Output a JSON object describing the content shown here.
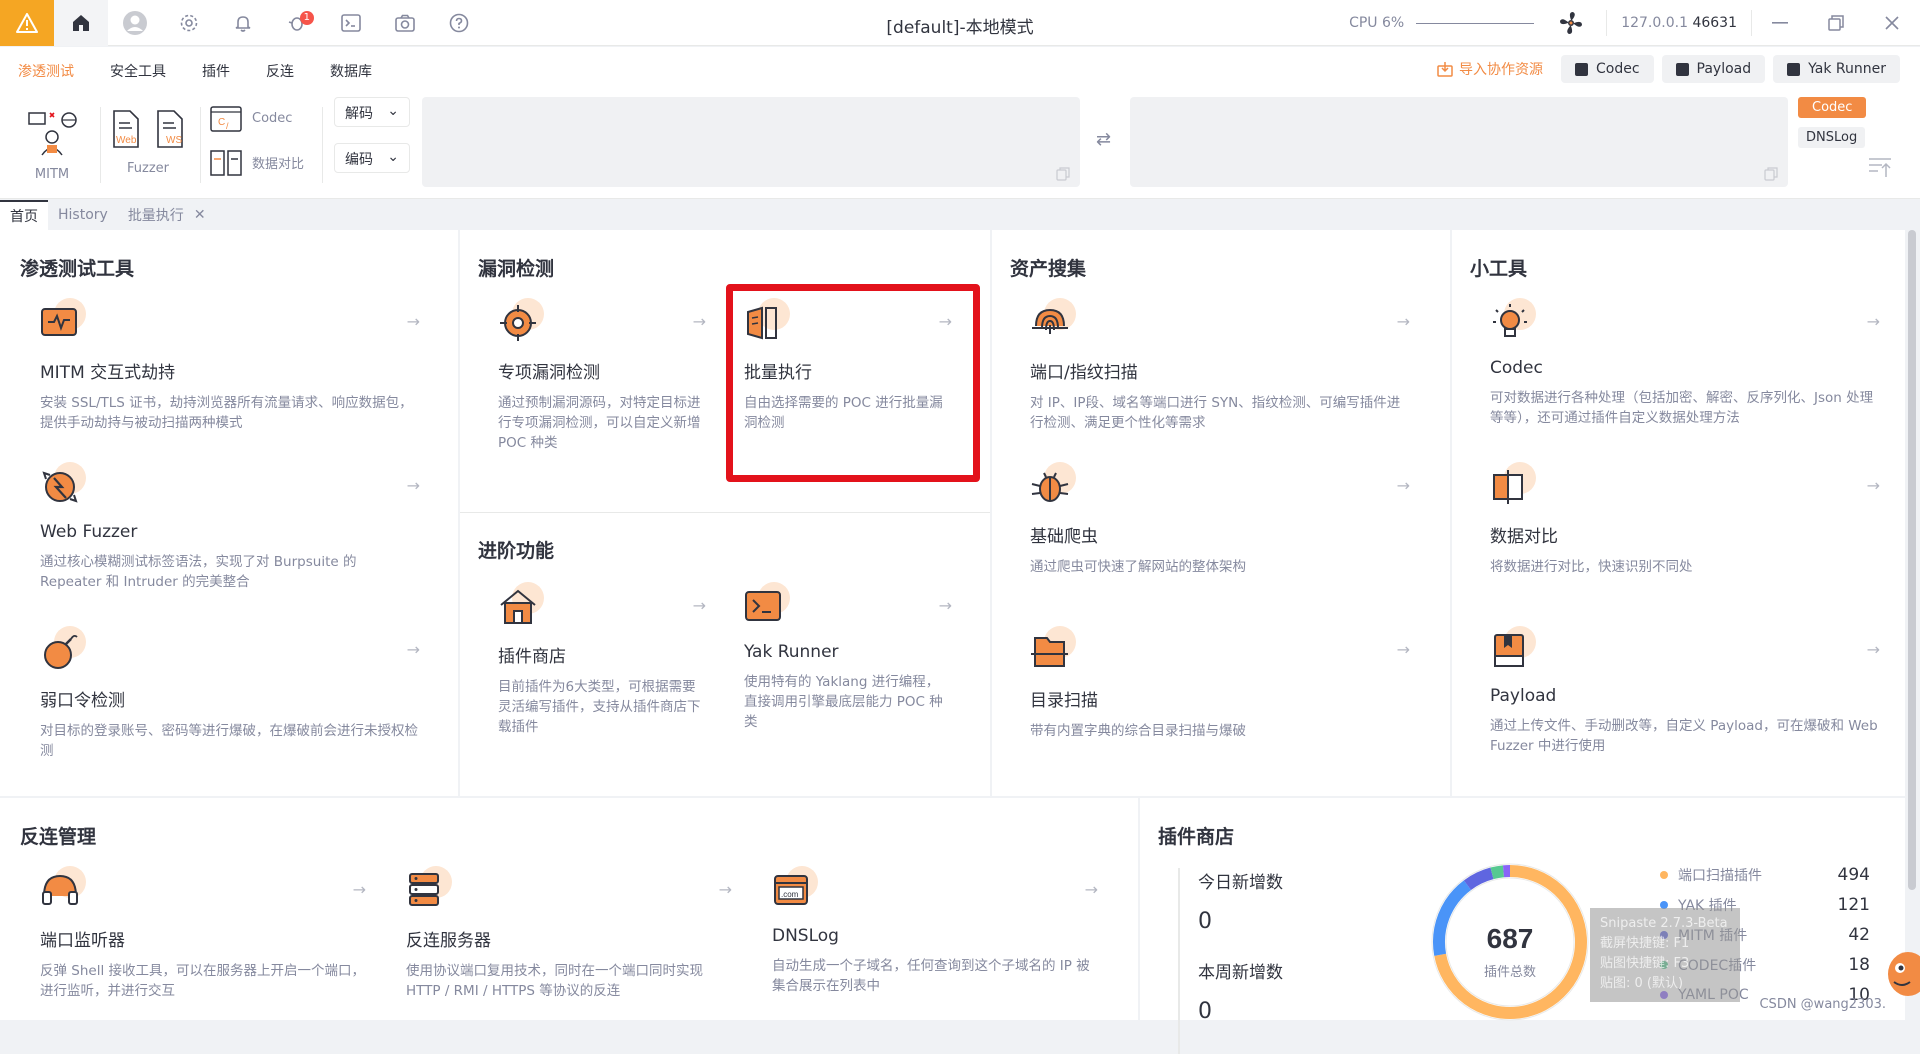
{
  "titlebar": {
    "title": "[default]-本地模式",
    "cpu": "CPU 6%",
    "addr_ip": "127.0.0.1",
    "addr_port": "46631",
    "notice_count": "1"
  },
  "menubar": {
    "items": [
      "渗透测试",
      "安全工具",
      "插件",
      "反连",
      "数据库"
    ],
    "active": "渗透测试",
    "import_label": "导入协作资源",
    "codec": "Codec",
    "payload": "Payload",
    "yak_runner": "Yak Runner"
  },
  "toolbar": {
    "mitm": "MITM",
    "fuzzer": "Fuzzer",
    "web_tag": "Web",
    "ws_tag": "WS",
    "codec": "Codec",
    "data_compare": "数据对比",
    "decode": "解码",
    "encode": "编码",
    "side_codec": "Codec",
    "side_dnslog": "DNSLog"
  },
  "tabs": [
    {
      "label": "首页",
      "active": true
    },
    {
      "label": "History",
      "active": false
    },
    {
      "label": "批量执行",
      "active": false,
      "closable": true
    }
  ],
  "sections": {
    "pentest": {
      "title": "渗透测试工具",
      "cards": [
        {
          "title": "MITM 交互式劫持",
          "desc": "安装 SSL/TLS 证书，劫持浏览器所有流量请求、响应数据包，提供手动劫持与被动扫描两种模式"
        },
        {
          "title": "Web Fuzzer",
          "desc": "通过核心模糊测试标签语法，实现了对 Burpsuite 的 Repeater 和 Intruder 的完美整合"
        },
        {
          "title": "弱口令检测",
          "desc": "对目标的登录账号、密码等进行爆破，在爆破前会进行未授权检测"
        }
      ]
    },
    "vuln": {
      "title": "漏洞检测",
      "cards": [
        {
          "title": "专项漏洞检测",
          "desc": "通过预制漏洞源码，对特定目标进行专项漏洞检测，可以自定义新增 POC 种类"
        },
        {
          "title": "批量执行",
          "desc": "自由选择需要的 POC 进行批量漏洞检测"
        }
      ]
    },
    "advanced": {
      "title": "进阶功能",
      "cards": [
        {
          "title": "插件商店",
          "desc": "目前插件为6大类型，可根据需要灵活编写插件，支持从插件商店下载插件"
        },
        {
          "title": "Yak Runner",
          "desc": "使用特有的 Yaklang 进行编程，直接调用引擎最底层能力 POC 种类"
        }
      ]
    },
    "asset": {
      "title": "资产搜集",
      "cards": [
        {
          "title": "端口/指纹扫描",
          "desc": "对 IP、IP段、域名等端口进行 SYN、指纹检测、可编写插件进行检测、满足更个性化等需求"
        },
        {
          "title": "基础爬虫",
          "desc": "通过爬虫可快速了解网站的整体架构"
        },
        {
          "title": "目录扫描",
          "desc": "带有内置字典的综合目录扫描与爆破"
        }
      ]
    },
    "tools": {
      "title": "小工具",
      "cards": [
        {
          "title": "Codec",
          "desc": "可对数据进行各种处理（包括加密、解密、反序列化、Json 处理等等），还可通过插件自定义数据处理方法"
        },
        {
          "title": "数据对比",
          "desc": "将数据进行对比，快速识别不同处"
        },
        {
          "title": "Payload",
          "desc": "通过上传文件、手动删改等，自定义 Payload，可在爆破和 Web Fuzzer 中进行使用"
        }
      ]
    },
    "reverse": {
      "title": "反连管理",
      "cards": [
        {
          "title": "端口监听器",
          "desc": "反弹 Shell 接收工具，可以在服务器上开启一个端口，进行监听，并进行交互"
        },
        {
          "title": "反连服务器",
          "desc": "使用协议端口复用技术，同时在一个端口同时实现 HTTP / RMI / HTTPS 等协议的反连"
        },
        {
          "title": "DNSLog",
          "desc": "自动生成一个子域名，任何查询到这个子域名的 IP 被集合展示在列表中"
        }
      ]
    },
    "store": {
      "title": "插件商店",
      "today_label": "今日新增数",
      "today_value": "0",
      "week_label": "本周新增数",
      "week_value": "0",
      "total": "687",
      "total_label": "插件总数",
      "legend": [
        {
          "name": "端口扫描插件",
          "value": "494",
          "color": "#ffb660"
        },
        {
          "name": "YAK 插件",
          "value": "121",
          "color": "#4a94f8"
        },
        {
          "name": "MITM 插件",
          "value": "42",
          "color": "#5f66e0"
        },
        {
          "name": "CODEC插件",
          "value": "18",
          "color": "#56c991"
        },
        {
          "name": "YAML POC",
          "value": "10",
          "color": "#8863f7"
        }
      ]
    }
  },
  "overlay": {
    "snip_lines": [
      "Snipaste 2.7.3-Beta",
      "截屏快捷键: F1",
      "贴图快捷键: F3",
      "贴图: 0 (默认)"
    ],
    "watermark": "CSDN @wang2303."
  }
}
